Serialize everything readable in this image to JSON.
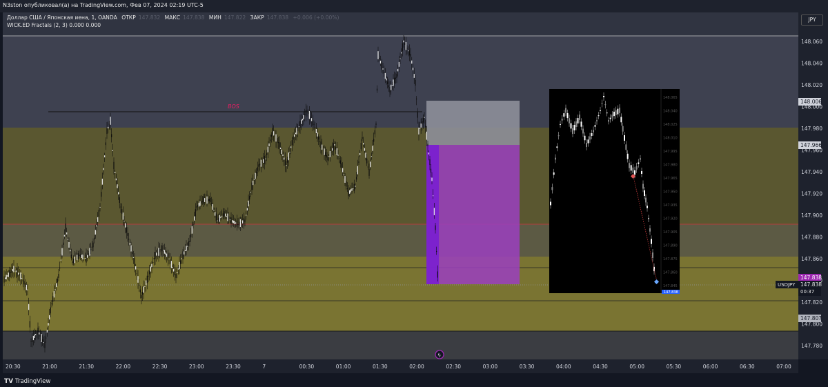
{
  "window": {
    "header_text": "N3ston опубликовал(а) на TradingView.com, Фев 07, 2024 02:19 UTC-5"
  },
  "legend": {
    "symbol_line": "Доллар США / Японская иена, 1, OANDA",
    "open_label": "ОТКР",
    "open_value": "147.832",
    "high_label": "МАКС",
    "high_value": "147.838",
    "low_label": "МИН",
    "low_value": "147.822",
    "close_label": "ЗАКР",
    "close_value": "147.838",
    "change": "+0.006 (+0.00%)",
    "indicator": "WICK.ED Fractals (2, 3)  0.000  0.000"
  },
  "chart": {
    "currency_button": "JPY",
    "bos_label": "BOS",
    "symbol_tag": "USDJPY",
    "countdown": "00:37",
    "price_ticks": [
      "148.060",
      "148.040",
      "148.020",
      "148.000",
      "147.980",
      "147.960",
      "147.940",
      "147.920",
      "147.900",
      "147.880",
      "147.860",
      "147.840",
      "147.820",
      "147.800",
      "147.780"
    ],
    "price_badges": [
      {
        "value": "148.006",
        "bg": "#d1d4dc",
        "fg": "#131722"
      },
      {
        "value": "147.966",
        "bg": "#d1d4dc",
        "fg": "#131722"
      },
      {
        "value": "147.838",
        "bg": "#9c27b0",
        "fg": "#ffffff"
      },
      {
        "value": "147.807",
        "bg": "#b2b5be",
        "fg": "#131722"
      }
    ],
    "time_ticks": [
      "20:30",
      "21:00",
      "21:30",
      "22:00",
      "22:30",
      "23:00",
      "23:30",
      "7",
      "00:30",
      "01:00",
      "01:30",
      "02:00",
      "02:30",
      "03:00",
      "03:30",
      "04:00",
      "04:30",
      "05:00",
      "05:30",
      "06:00",
      "06:30",
      "07:00"
    ],
    "colors": {
      "zone_upper": "#5a5730",
      "zone_lower": "#7a7432",
      "premium_zone": "#3e4150",
      "stop_box": "#8d8f99",
      "target_box": "#9b3fc0",
      "red_line": "#b23c3c",
      "bos_text": "#e91e63"
    }
  },
  "inset": {
    "price_ticks": [
      "148.065",
      "148.040",
      "148.025",
      "148.010",
      "147.995",
      "147.980",
      "147.965",
      "147.950",
      "147.935",
      "147.920",
      "147.905",
      "147.890",
      "147.875",
      "147.860",
      "147.845"
    ],
    "current_badge": "147.838"
  },
  "footer": {
    "brand": "TradingView"
  }
}
